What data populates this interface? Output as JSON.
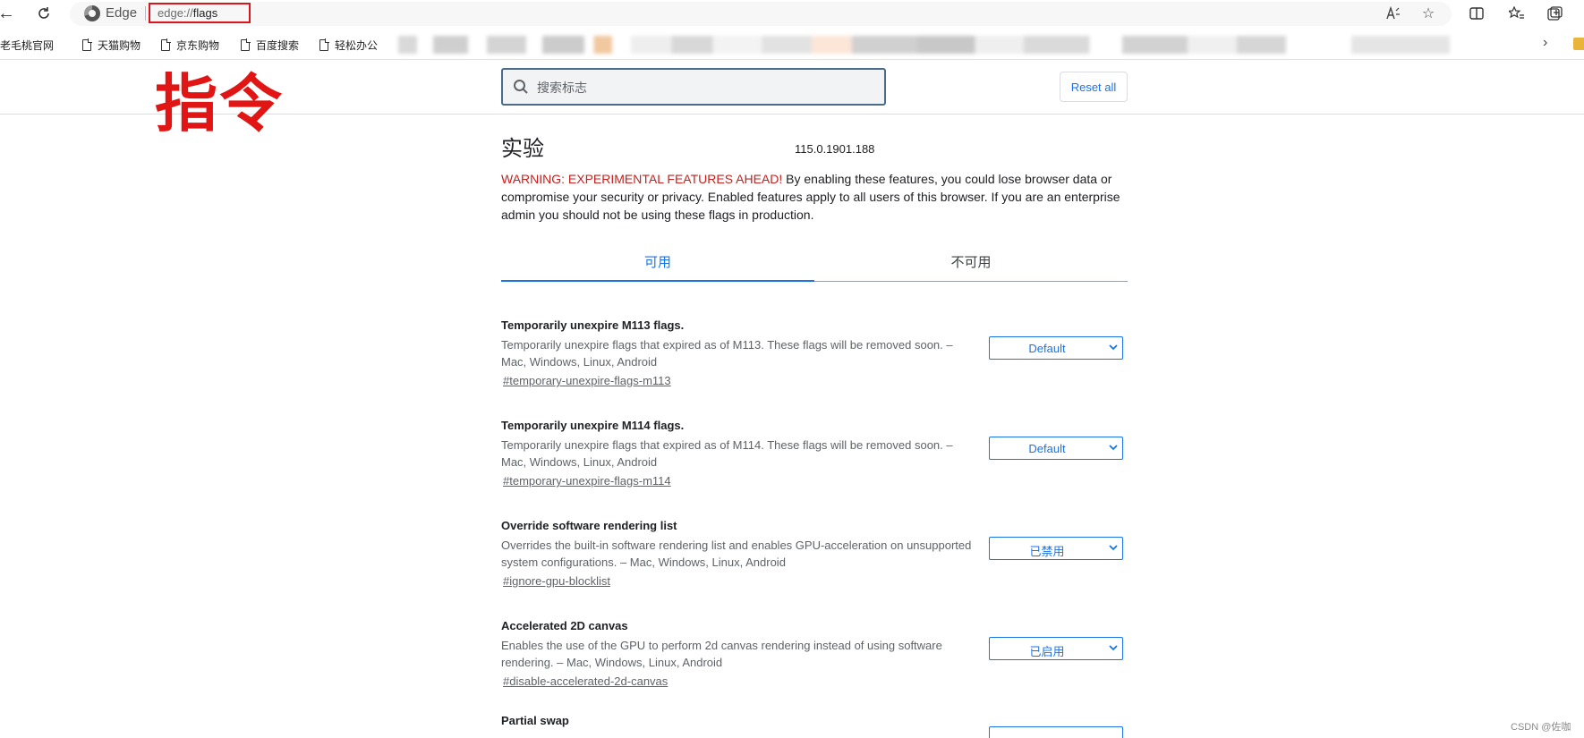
{
  "browser": {
    "site_label": "Edge",
    "url_scheme": "edge://",
    "url_path": "flags",
    "reader_label": "Aᴀ"
  },
  "favorites": [
    {
      "label": "老毛桃官网"
    },
    {
      "label": "天猫购物"
    },
    {
      "label": "京东购物"
    },
    {
      "label": "百度搜索"
    },
    {
      "label": "轻松办公"
    }
  ],
  "annotation": {
    "text": "指令",
    "color": "#e21515"
  },
  "search": {
    "placeholder": "搜索标志"
  },
  "reset_label": "Reset all",
  "page": {
    "title": "实验",
    "version": "115.0.1901.188",
    "warning_red": "WARNING: EXPERIMENTAL FEATURES AHEAD!",
    "warning_rest": " By enabling these features, you could lose browser data or compromise your security or privacy. Enabled features apply to all users of this browser. If you are an enterprise admin you should not be using these flags in production."
  },
  "tabs": [
    {
      "label": "可用",
      "active": true
    },
    {
      "label": "不可用",
      "active": false
    }
  ],
  "flags": [
    {
      "name": "Temporarily unexpire M113 flags.",
      "desc": "Temporarily unexpire flags that expired as of M113. These flags will be removed soon. – Mac, Windows, Linux, Android",
      "link": "#temporary-unexpire-flags-m113",
      "value": "Default"
    },
    {
      "name": "Temporarily unexpire M114 flags.",
      "desc": "Temporarily unexpire flags that expired as of M114. These flags will be removed soon. – Mac, Windows, Linux, Android",
      "link": "#temporary-unexpire-flags-m114",
      "value": "Default"
    },
    {
      "name": "Override software rendering list",
      "desc": "Overrides the built-in software rendering list and enables GPU-acceleration on unsupported system configurations. – Mac, Windows, Linux, Android",
      "link": "#ignore-gpu-blocklist",
      "value": "已禁用"
    },
    {
      "name": "Accelerated 2D canvas",
      "desc": "Enables the use of the GPU to perform 2d canvas rendering instead of using software rendering. – Mac, Windows, Linux, Android",
      "link": "#disable-accelerated-2d-canvas",
      "value": "已启用"
    },
    {
      "name": "Partial swap",
      "desc": "",
      "link": "",
      "value": ""
    }
  ],
  "watermark": "CSDN @佐咖",
  "colors": {
    "accent": "#1a73e8",
    "warning": "#c5221f",
    "annotation_red": "#e21515"
  }
}
